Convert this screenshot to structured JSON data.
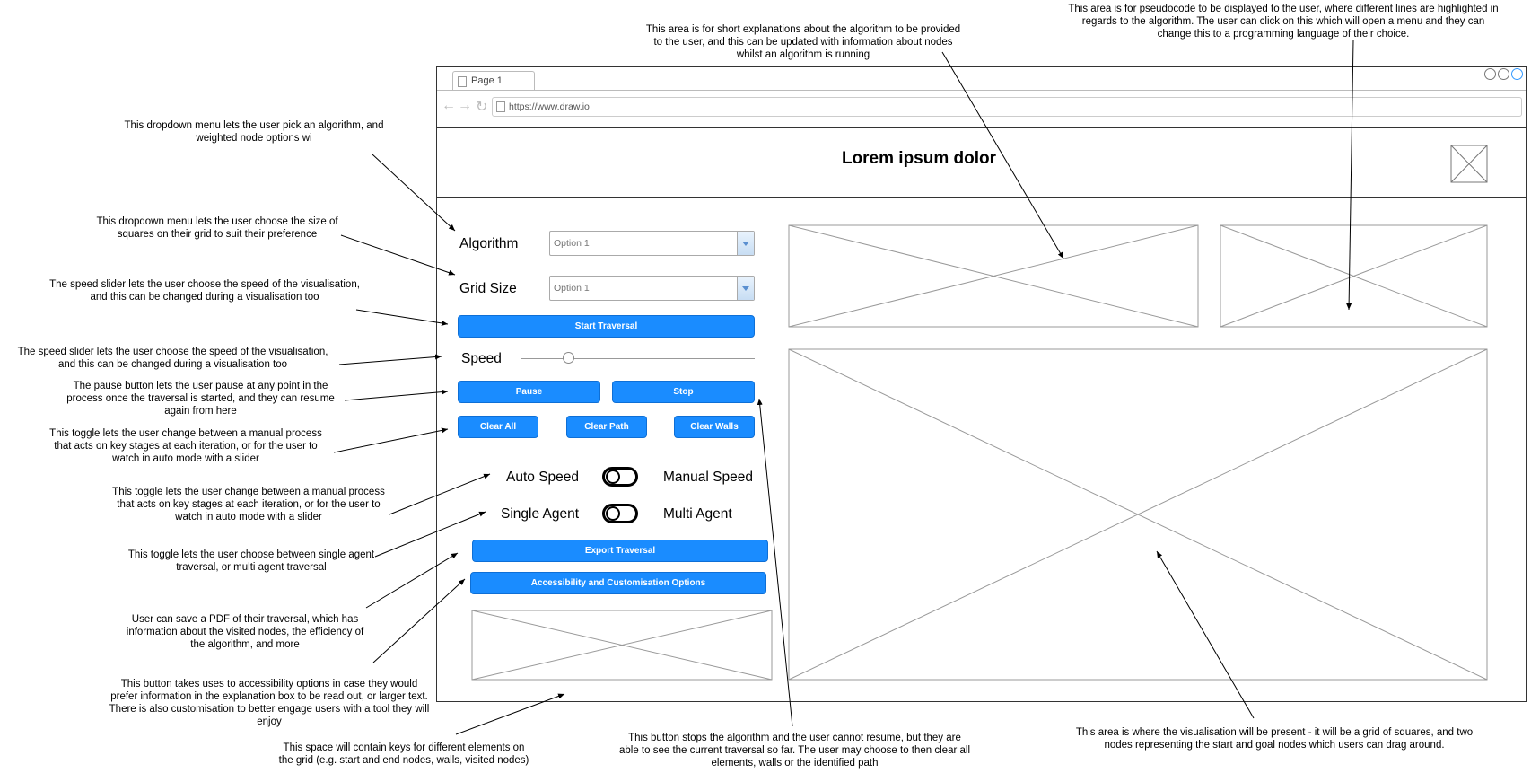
{
  "browser": {
    "tab_label": "Page 1",
    "url": "https://www.draw.io"
  },
  "header": {
    "title": "Lorem ipsum dolor"
  },
  "controls": {
    "algorithm_label": "Algorithm",
    "algorithm_value": "Option 1",
    "grid_size_label": "Grid Size",
    "grid_size_value": "Option 1",
    "start_button": "Start Traversal",
    "speed_label": "Speed",
    "pause_button": "Pause",
    "stop_button": "Stop",
    "clear_all_button": "Clear All",
    "clear_path_button": "Clear Path",
    "clear_walls_button": "Clear Walls",
    "auto_speed_label": "Auto Speed",
    "manual_speed_label": "Manual Speed",
    "single_agent_label": "Single Agent",
    "multi_agent_label": "Multi Agent",
    "export_button": "Export Traversal",
    "accessibility_button": "Accessibility and Customisation Options"
  },
  "annotations": {
    "explanation_area": "This area is for short explanations about the algorithm to be provided to the user, and this can be updated with information about nodes whilst an algorithm is running",
    "pseudocode_area": "This area is for pseudocode to be displayed to the user, where different lines are highlighted in regards to the algorithm. The user can click on this which will open a menu and they can change this to a programming language of their choice.",
    "algorithm_dropdown": "This dropdown menu lets the user pick an algorithm, and weighted node options wi",
    "grid_dropdown": "This dropdown menu lets the user choose the size of squares on their grid to suit their preference",
    "speed_slider_1": "The speed slider lets the user choose the speed of the visualisation, and this can be changed during a visualisation too",
    "speed_slider_2": "The speed slider lets the user choose the speed of the visualisation, and this can be changed during a visualisation too",
    "pause_button": "The pause button lets the user pause at any point in the process once the traversal is started, and they can resume again from here",
    "toggle_1": "This toggle lets the user change between a manual process that acts on key stages at each iteration, or for the user to watch in auto mode with a slider",
    "toggle_2": "This toggle lets the user change between a manual process that acts on key stages at each iteration, or for the user to watch in auto mode with a slider",
    "agent_toggle": "This toggle lets the user choose between single agent traversal, or multi agent traversal",
    "export": "User can save a PDF of their traversal, which has information about the visited nodes, the efficiency of the algorithm, and more",
    "accessibility": "This button takes uses to accessibility options in case they would prefer information in the explanation box to be read out, or larger text. There is also customisation to better engage users with a tool they will enjoy",
    "keys_space": "This space will contain keys for different elements on the grid (e.g. start and end nodes, walls, visited nodes)",
    "stop_button": "This button stops the algorithm and the user cannot resume, but they are able to see the current traversal so far. The user may choose to then clear all elements, walls or the identified path",
    "visualisation_area": "This area is where the visualisation will be present - it will be a grid of squares, and two nodes representing the start and goal nodes which users can drag around."
  },
  "colors": {
    "button_blue": "#1a8cff",
    "accent_circle": "#3399ff"
  }
}
